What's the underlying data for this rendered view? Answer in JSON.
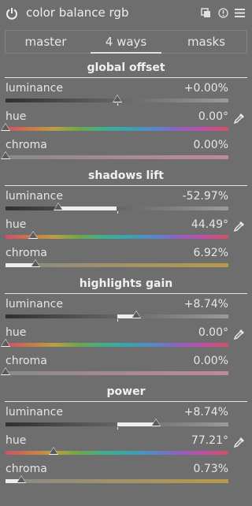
{
  "header": {
    "title": "color balance rgb",
    "icons": [
      "power-icon",
      "multi-instance-icon",
      "reset-icon",
      "presets-icon"
    ]
  },
  "tabs": [
    {
      "label": "master",
      "active": false
    },
    {
      "label": "4 ways",
      "active": true
    },
    {
      "label": "masks",
      "active": false
    }
  ],
  "sections": [
    {
      "title": "global offset",
      "sliders": [
        {
          "label": "luminance",
          "value": "+0.00%",
          "type": "gray",
          "position": 0.5,
          "picker": false
        },
        {
          "label": "hue",
          "value": "0.00°",
          "type": "hue",
          "position": 0.0,
          "picker": true
        },
        {
          "label": "chroma",
          "value": "0.00%",
          "type": "chroma-rose",
          "position": 0.0,
          "picker": false
        }
      ]
    },
    {
      "title": "shadows lift",
      "sliders": [
        {
          "label": "luminance",
          "value": "-52.97%",
          "type": "gray",
          "position": 0.235,
          "picker": false
        },
        {
          "label": "hue",
          "value": "44.49°",
          "type": "hue",
          "position": 0.124,
          "picker": true
        },
        {
          "label": "chroma",
          "value": "6.92%",
          "type": "chroma-gold",
          "position": 0.135,
          "picker": false
        }
      ]
    },
    {
      "title": "highlights gain",
      "sliders": [
        {
          "label": "luminance",
          "value": "+8.74%",
          "type": "gray",
          "position": 0.585,
          "picker": false
        },
        {
          "label": "hue",
          "value": "0.00°",
          "type": "hue",
          "position": 0.0,
          "picker": true
        },
        {
          "label": "chroma",
          "value": "0.00%",
          "type": "chroma-rose",
          "position": 0.0,
          "picker": false
        }
      ]
    },
    {
      "title": "power",
      "sliders": [
        {
          "label": "luminance",
          "value": "+8.74%",
          "type": "gray",
          "position": 0.675,
          "picker": false
        },
        {
          "label": "hue",
          "value": "77.21°",
          "type": "hue",
          "position": 0.215,
          "picker": true
        },
        {
          "label": "chroma",
          "value": "0.73%",
          "type": "chroma-gold",
          "position": 0.07,
          "picker": false
        }
      ]
    }
  ],
  "colors": {
    "background": "#6e6e6e",
    "text": "#e6e6e6",
    "fill": "#eeeeee"
  }
}
